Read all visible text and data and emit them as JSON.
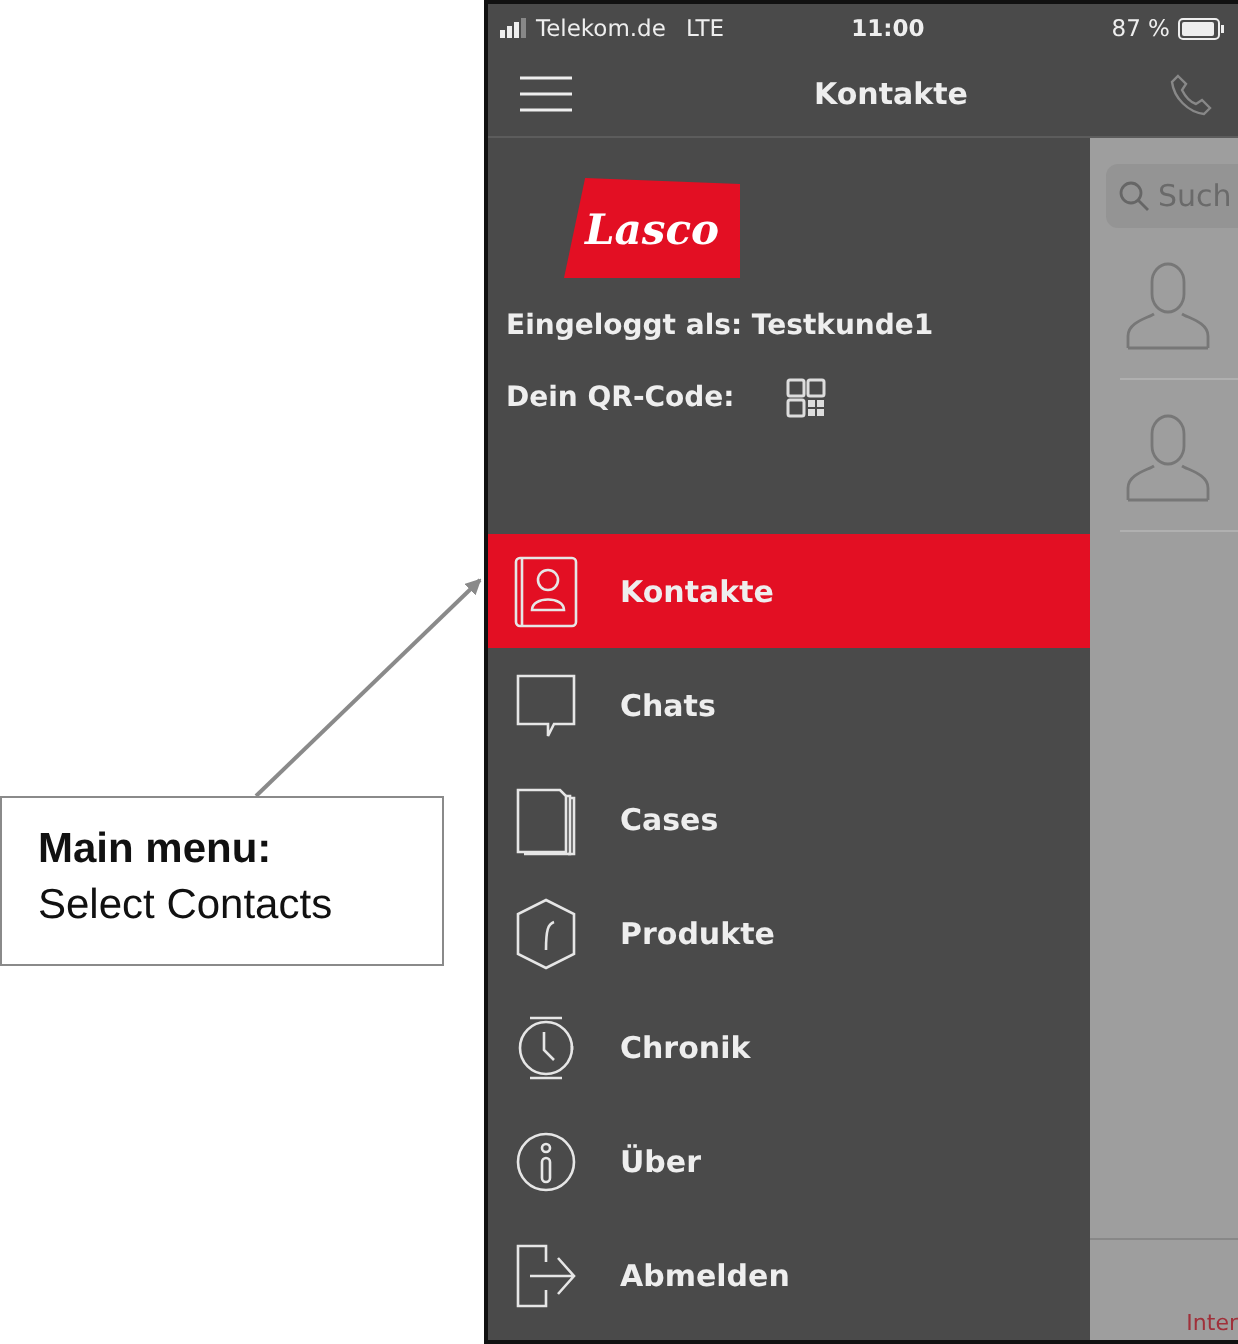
{
  "status_bar": {
    "carrier": "Telekom.de",
    "network": "LTE",
    "time": "11:00",
    "battery": "87 %"
  },
  "nav_bar": {
    "title": "Kontakte"
  },
  "drawer": {
    "logo": "Lasco",
    "login_label": "Eingeloggt als: Testkunde1",
    "qr_label": "Dein QR-Code:",
    "items": [
      {
        "label": "Kontakte",
        "kind": "contacts",
        "selected": true
      },
      {
        "label": "Chats",
        "kind": "chat",
        "selected": false
      },
      {
        "label": "Cases",
        "kind": "cases",
        "selected": false
      },
      {
        "label": "Produkte",
        "kind": "product",
        "selected": false
      },
      {
        "label": "Chronik",
        "kind": "history",
        "selected": false
      },
      {
        "label": "Über",
        "kind": "info",
        "selected": false
      },
      {
        "label": "Abmelden",
        "kind": "logout",
        "selected": false
      }
    ]
  },
  "background_screen": {
    "search": {
      "placeholder": "Such"
    },
    "footer_text": "Inter"
  },
  "annotation": {
    "title": "Main menu:",
    "text": "Select Contacts"
  }
}
